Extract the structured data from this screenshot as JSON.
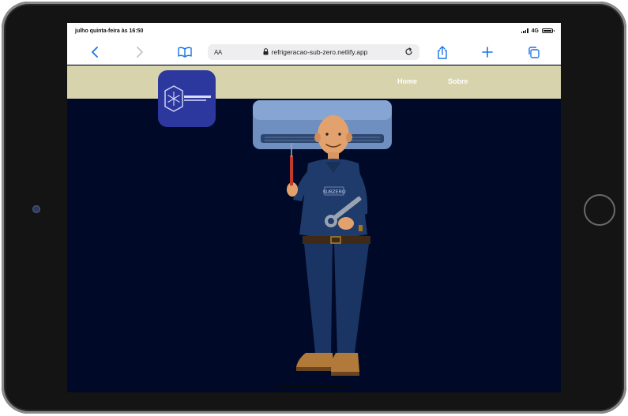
{
  "status_bar": {
    "time": "julho quinta-feira às 16:50",
    "network": "4G"
  },
  "browser": {
    "text_size_label": "AA",
    "url": "refrigeracao-sub-zero.netlify.app",
    "icons": [
      "back-icon",
      "forward-icon",
      "bookmarks-icon",
      "lock-icon",
      "reload-icon",
      "share-icon",
      "new-tab-icon",
      "tabs-icon"
    ]
  },
  "site": {
    "nav": {
      "home": "Home",
      "about": "Sobre"
    },
    "hero": {
      "shirt_text": "SUBZERO"
    }
  },
  "colors": {
    "nav_background": "#d6d3ad",
    "page_background": "#000a28",
    "logo_background": "#2d389f",
    "accent": "#1a73e8"
  }
}
